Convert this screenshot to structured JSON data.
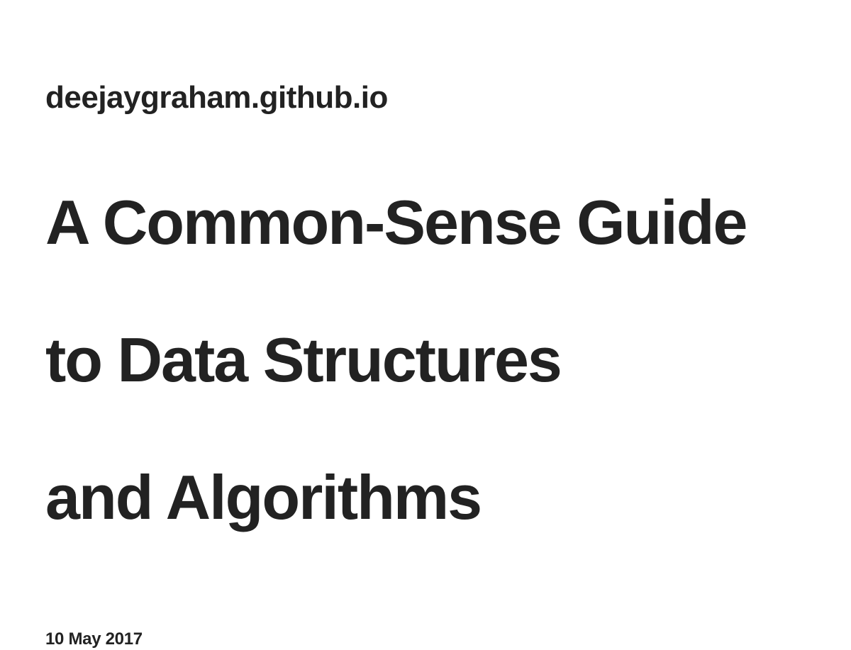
{
  "site": {
    "name": "deejaygraham.github.io"
  },
  "post": {
    "title_lines": [
      "A Common-Sense Guide",
      "to Data Structures",
      "and Algorithms"
    ],
    "date": "10 May 2017"
  },
  "colors": {
    "background": "#ffffff",
    "text": "#222222"
  }
}
